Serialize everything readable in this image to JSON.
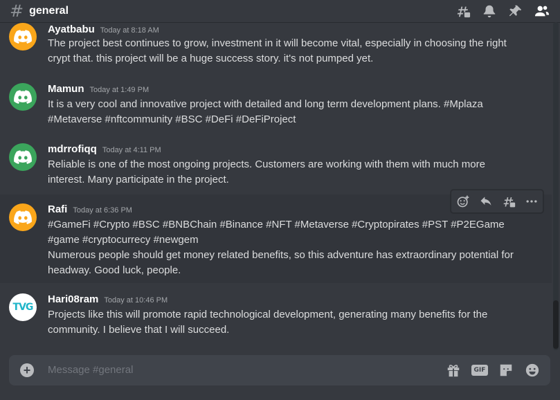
{
  "header": {
    "hash": "#",
    "channel": "general"
  },
  "messages": [
    {
      "author": "Ayatbabu",
      "timestamp": "Today at 8:18 AM",
      "avatar": "discord-logo-orange",
      "lines": [
        "The project best continues to grow, investment in it will become vital, especially in choosing the right",
        "crypt that. this project will be a huge success story. it's not pumped yet."
      ]
    },
    {
      "author": "Mamun",
      "timestamp": "Today at 1:49 PM",
      "avatar": "discord-logo-green",
      "lines": [
        "It is a very cool and innovative project with detailed and long term development plans. #Mplaza",
        "#Metaverse #nftcommunity #BSC  #DeFi #DeFiProject"
      ]
    },
    {
      "author": "mdrrofiqq",
      "timestamp": "Today at 4:11 PM",
      "avatar": "discord-logo-green",
      "lines": [
        "Reliable is one of the most ongoing projects.  Customers are working with them with much more",
        "interest.  Many participate in the project."
      ]
    },
    {
      "author": "Rafi",
      "timestamp": "Today at 6:36 PM",
      "avatar": "discord-logo-orange",
      "lines": [
        "#GameFi #Crypto #BSC #BNBChain #Binance   #NFT #Metaverse #Cryptopirates #PST #P2EGame",
        "#game #cryptocurrecy #newgem",
        "Numerous people should get money related benefits, so this adventure has extraordinary potential for",
        "headway. Good luck, people."
      ]
    },
    {
      "author": "Hari08ram",
      "timestamp": "Today at 10:46 PM",
      "avatar": "tvg-logo",
      "avatar_text": "TVG",
      "lines": [
        "Projects like this will promote rapid technological development, generating many benefits for the",
        "community. I believe that I will succeed."
      ]
    }
  ],
  "composer": {
    "placeholder": "Message #general",
    "gif_label": "GIF"
  },
  "colors": {
    "orange": "#faa61a",
    "green": "#3ba55c",
    "tvg": "#1fb5c9"
  }
}
